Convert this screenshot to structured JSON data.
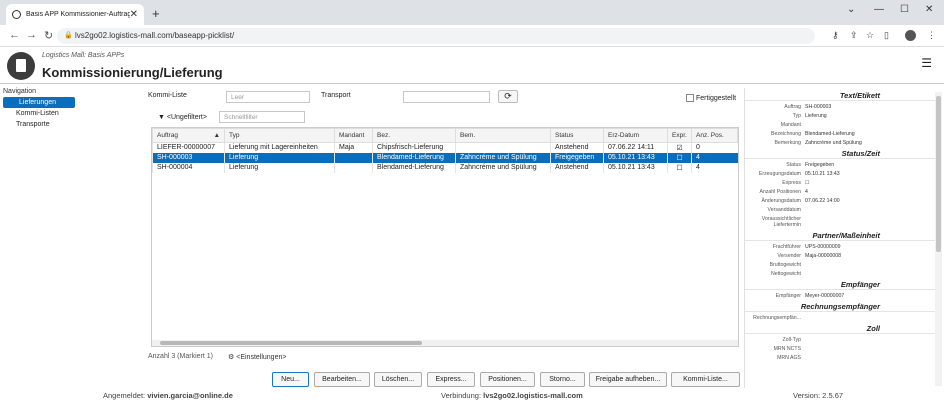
{
  "browser": {
    "tab_title": "Basis APP Kommissionier-Auftrag",
    "url": "lvs2go02.logistics-mall.com/baseapp-picklist/"
  },
  "app": {
    "subtitle": "Logistics Mall: Basis APPs",
    "title": "Kommissionierung/Lieferung"
  },
  "nav": {
    "header": "Navigation",
    "items": [
      {
        "label": "Lieferungen"
      },
      {
        "label": "Kommi-Listen"
      },
      {
        "label": "Transporte"
      }
    ]
  },
  "filters": {
    "kommi_label": "Kommi-Liste",
    "kommi_value": "Leer",
    "transport_label": "Transport",
    "done_label": "Fertiggestellt",
    "filter_label": "<Ungefiltert>",
    "quick_placeholder": "Schnellfilter"
  },
  "table": {
    "columns": [
      "Auftrag",
      "Typ",
      "Mandant",
      "Bez.",
      "Bem.",
      "Status",
      "Erz-Datum",
      "Expr.",
      "Anz. Pos."
    ],
    "rows": [
      {
        "auftrag": "LIEFER-00000007",
        "typ": "Lieferung mit Lagereinheiten",
        "mandant": "Maja",
        "bez": "Chipsfrisch-Lieferung",
        "bem": "",
        "status": "Anstehend",
        "datum": "07.06.22 14:11",
        "expr": "☑",
        "anz": "0"
      },
      {
        "auftrag": "SH-000003",
        "typ": "Lieferung",
        "mandant": "",
        "bez": "Blendamed-Lieferung",
        "bem": "Zahncréme und Spülung",
        "status": "Freigegeben",
        "datum": "05.10.21 13:43",
        "expr": "☐",
        "anz": "4"
      },
      {
        "auftrag": "SH-000004",
        "typ": "Lieferung",
        "mandant": "",
        "bez": "Blendamed-Lieferung",
        "bem": "Zahncréme und Spülung",
        "status": "Anstehend",
        "datum": "05.10.21 13:43",
        "expr": "☐",
        "anz": "4"
      }
    ]
  },
  "count": "Anzahl 3 (Markiert 1)",
  "settings": "<Einstellungen>",
  "buttons": [
    "Neu...",
    "Bearbeiten...",
    "Löschen...",
    "Express...",
    "Positionen...",
    "Storno...",
    "Freigabe aufheben...",
    "Kommi-Liste..."
  ],
  "panel": {
    "s1": "Text/Etikett",
    "text": [
      [
        "Auftrag",
        "SH-000003"
      ],
      [
        "Typ",
        "Lieferung"
      ],
      [
        "Mandant",
        ""
      ],
      [
        "Bezeichnung",
        "Blendamed-Lieferung"
      ],
      [
        "Bemerkung",
        "Zahncréme und Spülung"
      ]
    ],
    "s2": "Status/Zeit",
    "status": [
      [
        "Status",
        "Freigegeben"
      ],
      [
        "Erzeugungsdatum",
        "05.10.21 13:43"
      ],
      [
        "Express",
        "☐"
      ],
      [
        "Anzahl Positionen",
        "4"
      ],
      [
        "Änderungsdatum",
        "07.06.22 14:00"
      ],
      [
        "Versanddatum",
        ""
      ],
      [
        "Voraussichtlicher Liefertermin",
        ""
      ]
    ],
    "s3": "Partner/Maßeinheit",
    "partner": [
      [
        "Frachtführer",
        "UPS-00000009"
      ],
      [
        "Versender",
        "Maja-00000008"
      ],
      [
        "Bruttogewicht",
        ""
      ],
      [
        "Nettogewicht",
        ""
      ]
    ],
    "s4": "Empfänger",
    "empf": [
      [
        "Empfänger",
        "Meyer-00000007"
      ]
    ],
    "s5": "Rechnungsempfänger",
    "rech": [
      [
        "Rechnungsempfän...",
        ""
      ]
    ],
    "s6": "Zoll",
    "zoll": [
      [
        "Zoll-Typ",
        ""
      ],
      [
        "MRN NCTS",
        ""
      ],
      [
        "MRN AGS",
        ""
      ]
    ]
  },
  "footer": {
    "user_label": "Angemeldet: ",
    "user": "vivien.garcia@online.de",
    "conn_label": "Verbindung: ",
    "conn": "lvs2go02.logistics-mall.com",
    "version": "Version: 2.5.67"
  }
}
